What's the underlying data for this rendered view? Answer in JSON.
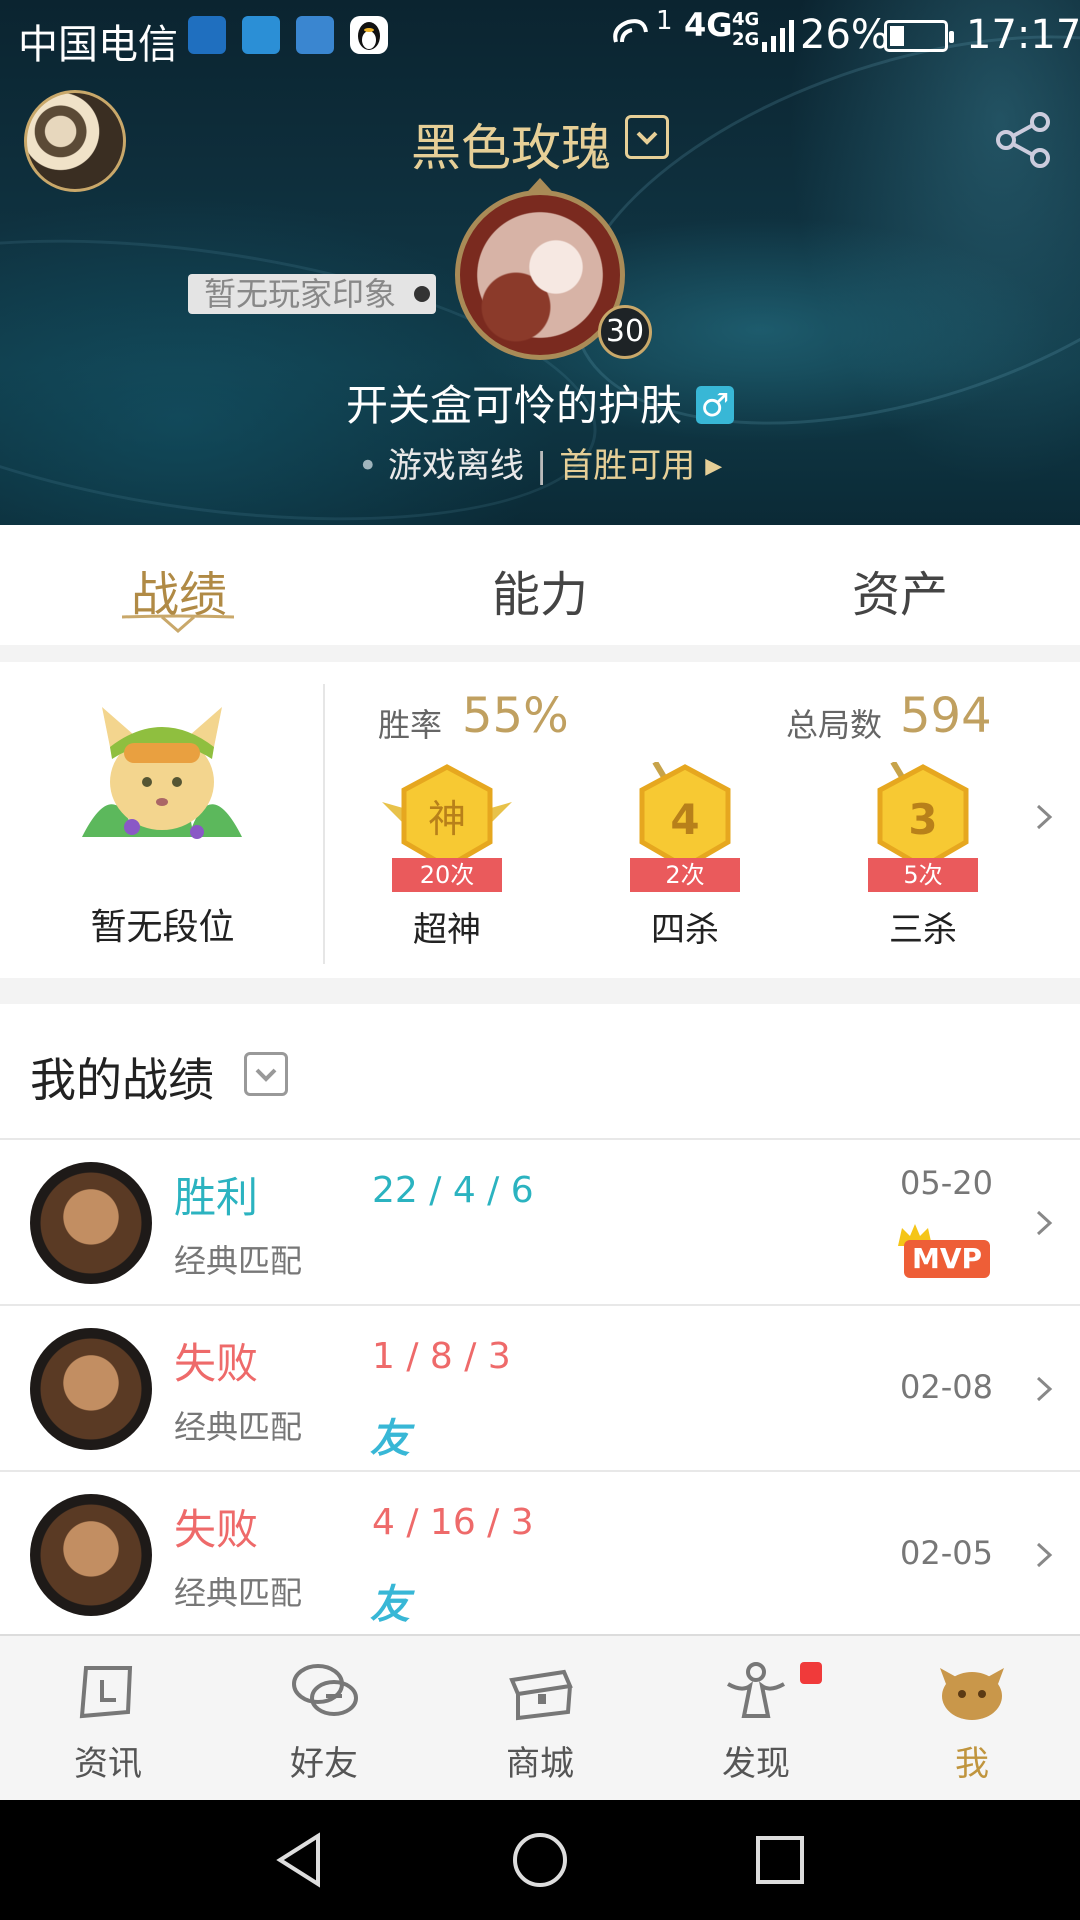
{
  "status_bar": {
    "carrier": "中国电信",
    "network": "4G",
    "network2": "4G 2G",
    "signal_sup": "1",
    "battery_pct": "26%",
    "time": "17:17",
    "app_icons": [
      "anchor-icon",
      "exui-icon",
      "health-icon",
      "qq-penguin-icon"
    ]
  },
  "header": {
    "player_title": "黑色玫瑰",
    "impression": "暂无玩家印象",
    "level": "30",
    "nickname": "开关盒可怜的护肤",
    "gender_symbol": "♂",
    "game_state": "游戏离线",
    "separator": "|",
    "first_win": "首胜可用"
  },
  "tabs": [
    {
      "label": "战绩",
      "active": true
    },
    {
      "label": "能力",
      "active": false
    },
    {
      "label": "资产",
      "active": false
    }
  ],
  "stats": {
    "rank_label": "暂无段位",
    "winrate_label": "胜率",
    "winrate_value": "55%",
    "total_label": "总局数",
    "total_value": "594",
    "medals": [
      {
        "glyph": "神",
        "count": "20次",
        "name": "超神"
      },
      {
        "glyph": "4",
        "count": "2次",
        "name": "四杀"
      },
      {
        "glyph": "3",
        "count": "5次",
        "name": "三杀"
      }
    ]
  },
  "records": {
    "title": "我的战绩",
    "rows": [
      {
        "result": "胜利",
        "kda": "22 / 4 / 6",
        "mode": "经典匹配",
        "date": "05-20",
        "badge": "MVP",
        "friend": "",
        "outcome": "win"
      },
      {
        "result": "失败",
        "kda": "1 / 8 / 3",
        "mode": "经典匹配",
        "date": "02-08",
        "badge": "",
        "friend": "友",
        "outcome": "loss"
      },
      {
        "result": "失败",
        "kda": "4 / 16 / 3",
        "mode": "经典匹配",
        "date": "02-05",
        "badge": "",
        "friend": "友",
        "outcome": "loss"
      }
    ]
  },
  "bottom_nav": [
    {
      "label": "资讯",
      "icon": "news-icon",
      "active": false
    },
    {
      "label": "好友",
      "icon": "chat-bubbles-icon",
      "active": false
    },
    {
      "label": "商城",
      "icon": "treasure-chest-icon",
      "active": false
    },
    {
      "label": "发现",
      "icon": "discover-icon",
      "active": false,
      "badge_dot": true
    },
    {
      "label": "我",
      "icon": "poro-me-icon",
      "active": true
    }
  ],
  "colors": {
    "gold": "#c0a060",
    "win": "#2bb3c0",
    "loss": "#ee6a6a",
    "medal_ribbon": "#ea5a5c",
    "mvp": "#ee5e37"
  }
}
